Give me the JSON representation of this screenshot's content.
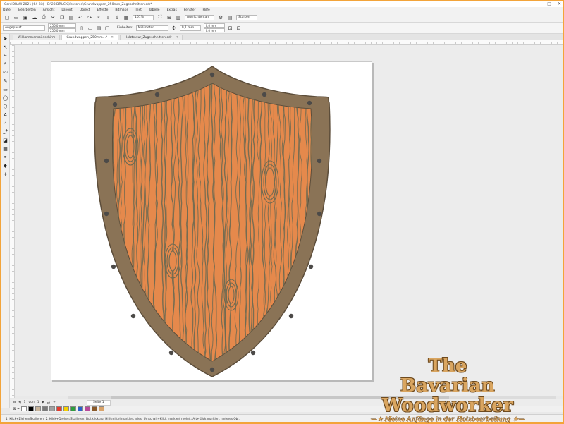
{
  "window": {
    "title": "CorelDRAW 2021 (64-Bit) - E:\\28 DRUCK\\Vektoren\\Grundwappen_250mm_Zugeschnitten.cdr*",
    "controls": [
      "–",
      "□",
      "✕"
    ]
  },
  "menu": [
    "Datei",
    "Bearbeiten",
    "Ansicht",
    "Layout",
    "Objekt",
    "Effekte",
    "Bitmaps",
    "Text",
    "Tabelle",
    "Extras",
    "Fenster",
    "Hilfe"
  ],
  "toolbar": {
    "zoom": "161%",
    "snap": "Ausrichten an",
    "launch": "Starten"
  },
  "propertybar": {
    "preset": "Angepasst",
    "width": "256,0 mm",
    "height": "256,0 mm",
    "units_label": "Einheiten:",
    "units": "Millimeter",
    "nudge": "0,1 mm",
    "dup_x": "0,0 mm",
    "dup_y": "0,0 mm"
  },
  "doc_tabs": [
    {
      "label": "Willkommensbildschirm",
      "active": false
    },
    {
      "label": "Grundwappen_250mm...*",
      "active": true
    },
    {
      "label": "Holztextur_Zugeschnitten.cdr",
      "active": false
    }
  ],
  "pagebar": {
    "page_pos": "1",
    "of": "von",
    "page_total": "1",
    "page_tab": "Seite 1"
  },
  "palette": [
    "#ffffff",
    "#000000",
    "#c8b49a",
    "#7a7a7a",
    "#a0a0a0",
    "#e63b2e",
    "#f5d000",
    "#2e9e3f",
    "#2a62c9",
    "#b84a9a",
    "#8a5a2a",
    "#d9a36a"
  ],
  "status": "1. Klick+Ziehen/Skalieren; 2. Klick+Drehen/Skalieren; Dpl.klick auf Hilfsmittel markiert alles; Umschalt+Klick markiert mehrf.; Alt+Klick markiert hinteres Obj.",
  "shield": {
    "border_color": "#8a7356",
    "border_outline": "#5c4d3a",
    "wood_color": "#e5894c",
    "grain_color": "#6d6a52",
    "rivet_color": "#4c4a48"
  },
  "watermark": {
    "line1": "The",
    "line2": "Bavarian Woodworker",
    "line3": "—★ Meine Anfänge in der Holzbearbeitung ★—"
  }
}
